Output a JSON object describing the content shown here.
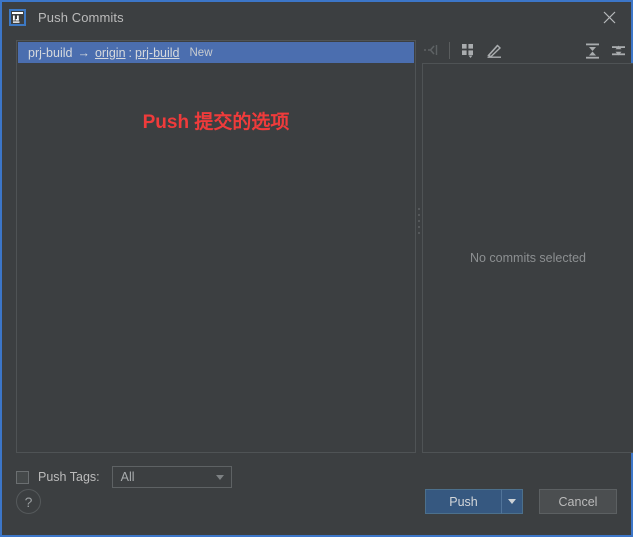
{
  "window": {
    "title": "Push Commits",
    "logo_icon": "intellij-idea-icon",
    "close_icon": "close-icon",
    "accent_color": "#3c76c8",
    "background_color": "#3c3f41"
  },
  "toolbar": {
    "items": [
      {
        "name": "collapse-selection-icon",
        "label": "",
        "disabled": true
      },
      {
        "name": "group-by-icon",
        "label": "",
        "disabled": false
      },
      {
        "name": "edit-icon",
        "label": "",
        "disabled": false
      },
      {
        "name": "expand-all-icon",
        "label": "",
        "disabled": false
      },
      {
        "name": "collapse-all-icon",
        "label": "",
        "disabled": false
      }
    ]
  },
  "commits_tree": {
    "selected_row": {
      "source_branch": "prj-build",
      "arrow": "→",
      "remote": "origin",
      "separator": ":",
      "target_branch": "prj-build",
      "badge": "New",
      "selected_color": "#4b6eaf"
    },
    "annotation": "Push 提交的选项",
    "annotation_color": "#ef3b3b"
  },
  "details_panel": {
    "empty_text": "No commits selected"
  },
  "push_tags": {
    "checkbox_label": "Push Tags:",
    "checked": false,
    "dropdown_value": "All",
    "dropdown_options": [
      "All"
    ]
  },
  "footer": {
    "help_label": "?",
    "push_label": "Push",
    "push_split_icon": "chevron-down-icon",
    "cancel_label": "Cancel"
  }
}
